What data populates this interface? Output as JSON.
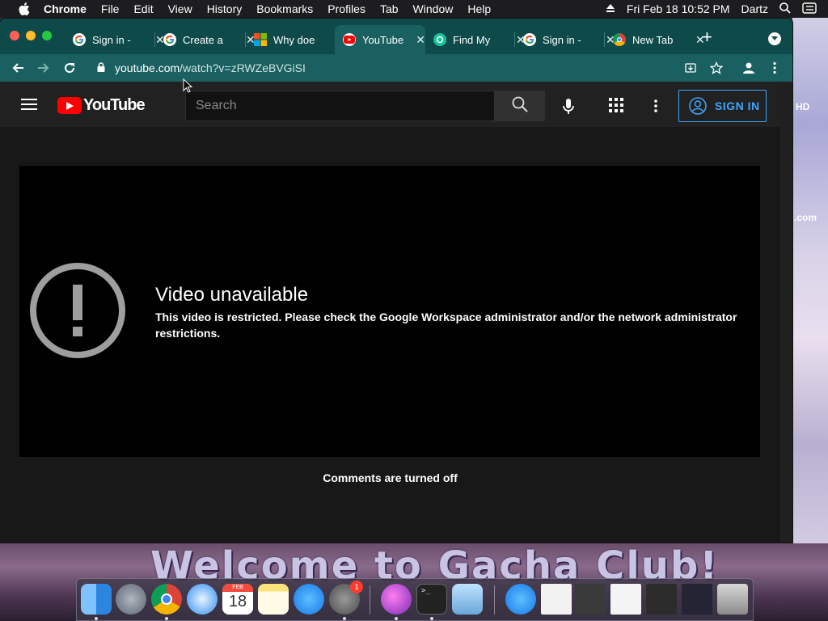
{
  "menubar": {
    "app": "Chrome",
    "items": [
      "File",
      "Edit",
      "View",
      "History",
      "Bookmarks",
      "Profiles",
      "Tab",
      "Window",
      "Help"
    ],
    "clock": "Fri Feb 18  10:52 PM",
    "user": "Dartz"
  },
  "tabs": [
    {
      "title": "Sign in -",
      "favicon": "google-icon"
    },
    {
      "title": "Create a",
      "favicon": "google-icon"
    },
    {
      "title": "Why doe",
      "favicon": "microsoft-icon"
    },
    {
      "title": "YouTube",
      "favicon": "youtube-icon",
      "active": true
    },
    {
      "title": "Find My",
      "favicon": "grammarly-icon"
    },
    {
      "title": "Sign in -",
      "favicon": "google-icon"
    },
    {
      "title": "New Tab",
      "favicon": "chrome-icon"
    }
  ],
  "address": {
    "domain": "youtube.com",
    "path": "/watch?v=zRWZeBVGiSI"
  },
  "youtube": {
    "logo_text": "YouTube",
    "search_placeholder": "Search",
    "sign_in": "SIGN IN",
    "error_title": "Video unavailable",
    "error_message": "This video is restricted. Please check the Google Workspace administrator and/or the network administrator restrictions.",
    "comments_status": "Comments are turned off"
  },
  "wallpaper": {
    "banner": "Welcome to Gacha Club!",
    "badge_hd": "HD",
    "badge_com": ".com"
  },
  "dock": {
    "apps": [
      "finder",
      "launchpad",
      "chrome",
      "safari",
      "calendar",
      "notes",
      "app-store",
      "system-preferences",
      "gacha",
      "terminal",
      "preview",
      "app-store-2",
      "archive",
      "window-1",
      "window-2",
      "window-3",
      "window-4",
      "trash"
    ],
    "calendar_month": "FEB",
    "calendar_day": "18",
    "settings_badge": "1"
  }
}
